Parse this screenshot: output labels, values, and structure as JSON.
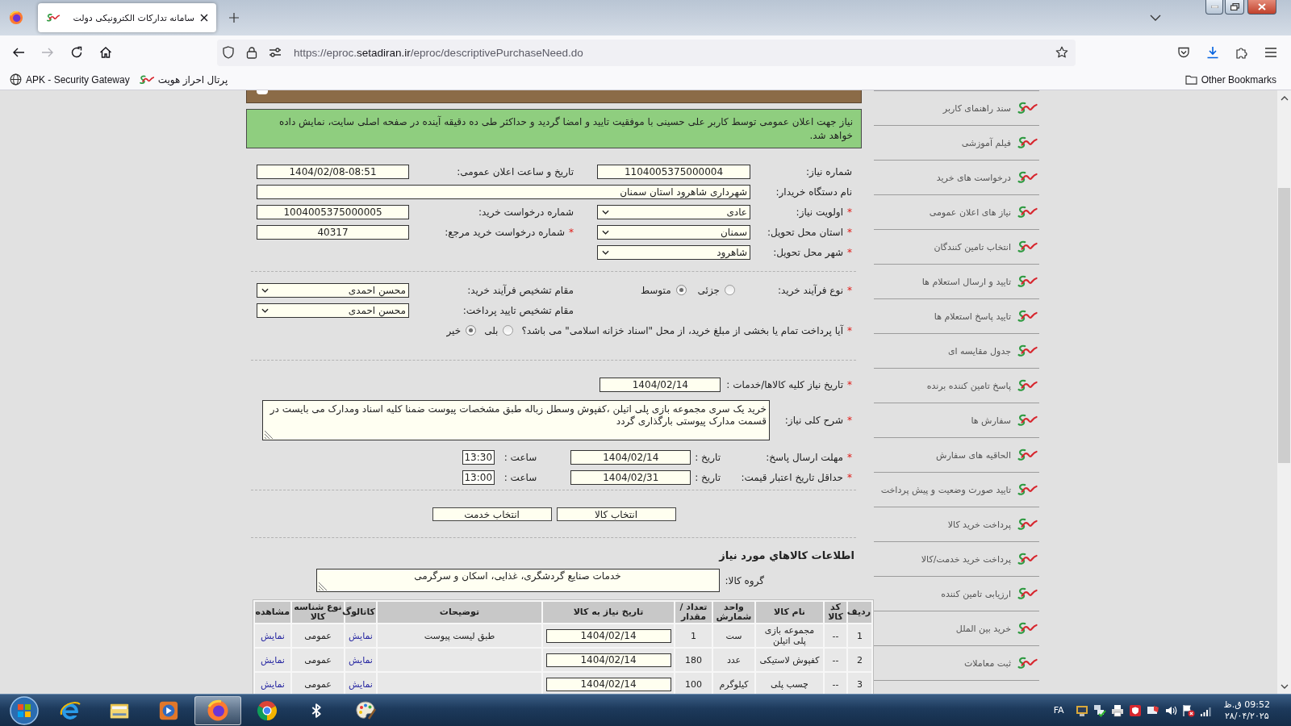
{
  "browser": {
    "tabs": [
      {
        "title": "سامانه تدارکات الکترونیکی دولت",
        "selected": true
      }
    ],
    "nav_buttons": [
      {
        "kind": "back",
        "disabled": false
      },
      {
        "kind": "forward",
        "disabled": true
      },
      {
        "kind": "reload",
        "disabled": false
      },
      {
        "kind": "home",
        "disabled": false
      }
    ],
    "address": {
      "prefix": "https://eproc.",
      "domain": "setadiran.ir",
      "path": "/eproc/descriptivePurchaseNeed.do"
    },
    "bookmarks_bar": {
      "gateway_bookmark": "APK - Security Gateway",
      "portal_bookmark": "پرتال احراز هویت",
      "other_bookmarks": "Other Bookmarks"
    }
  },
  "page": {
    "notice": "نیاز جهت اعلان عمومی توسط کاربر علی حسینی با موفقیت تایید و امضا گردید و حداکثر طی ده دقیقه آینده در صفحه اصلی سایت، نمایش داده خواهد شد.",
    "general_fields": [
      {
        "right": {
          "label": "شماره نیاز:",
          "kind": "text",
          "value": "1104005375000004"
        },
        "left": {
          "label": "تاریخ و ساعت اعلان عمومی:",
          "kind": "text",
          "value": "1404/02/08-08:51"
        }
      },
      {
        "right": {
          "label": "نام دستگاه خریدار:",
          "kind": "wide",
          "value": "شهرداری شاهرود استان سمنان"
        }
      },
      {
        "right": {
          "required_mark": "*",
          "label": "اولویت نیاز:",
          "kind": "select",
          "value": "عادی"
        },
        "left": {
          "label": "شماره درخواست خرید:",
          "kind": "text",
          "value": "1004005375000005"
        }
      },
      {
        "right": {
          "required_mark": "*",
          "label": "استان محل تحویل:",
          "kind": "select",
          "value": "سمنان"
        },
        "left": {
          "required_mark": "*",
          "label": "شماره درخواست خرید مرجع:",
          "kind": "text",
          "value": "40317"
        }
      },
      {
        "right": {
          "required_mark": "*",
          "label": "شهر محل تحویل:",
          "kind": "select",
          "value": "شاهرود"
        }
      }
    ],
    "process_fields": [
      {
        "right": {
          "required_mark": "*",
          "label": "نوع فرآیند خرید:",
          "kind": "radio",
          "options": [
            {
              "label": "جزئی",
              "selected": false
            },
            {
              "label": "متوسط",
              "selected": true
            }
          ]
        },
        "left": {
          "label": "مقام تشخیص فرآیند خرید:",
          "kind": "select",
          "value": "محسن احمدی"
        }
      },
      {
        "left": {
          "label": "مقام تشخیص تایید پرداخت:",
          "kind": "select",
          "value": "محسن احمدی"
        }
      }
    ],
    "treasury_question": {
      "required_mark": "*",
      "label": "آیا پرداخت تمام یا بخشی از مبلغ خرید، از محل \"اسناد خزانه اسلامی\" می باشد؟",
      "options": [
        {
          "label": "بلی",
          "selected": false
        },
        {
          "label": "خیر",
          "selected": true
        }
      ]
    },
    "need_date": {
      "required_mark": "*",
      "label": "تاریخ نیاز کلیه کالاها/خدمات :",
      "value": "1404/02/14"
    },
    "description": {
      "required_mark": "*",
      "label": "شرح کلی نیاز:",
      "value": "خرید یک سری مجموعه بازی پلی اتیلن ،کفپوش وسطل زباله طبق مشخصات پیوست ضمنا کلیه اسناد ومدارک می بایست در قسمت مدارک پیوستی بارگذاری گردد"
    },
    "deadlines": [
      {
        "required_mark": "*",
        "label": "مهلت ارسال پاسخ:",
        "date_label": "تاریخ :",
        "date": "1404/02/14",
        "time_label": "ساعت :",
        "time": "13:30"
      },
      {
        "required_mark": "*",
        "label": "حداقل تاریخ اعتبار قیمت:",
        "date_label": "تاریخ :",
        "date": "1404/02/31",
        "time_label": "ساعت :",
        "time": "13:00"
      }
    ],
    "buttons": [
      "انتخاب کالا",
      "انتخاب خدمت"
    ],
    "goods_title": "اطلاعات کالاهاي مورد نياز",
    "goods_group": {
      "label": "گروه کالا:",
      "value": "خدمات صنایع گردشگری، غذایی، اسکان و سرگرمی"
    },
    "table": {
      "columns": [
        "ردیف",
        "کد کالا",
        "نام کالا",
        "واحد شمارش",
        "تعداد / مقدار",
        "تاریخ نیاز به کالا",
        "توضیحات",
        "کاتالوگ",
        "نوع شناسه کالا",
        "مشاهده"
      ],
      "rows": [
        {
          "index": "1",
          "code": "--",
          "name": "مجموعه بازی پلی اتیلن",
          "unit": "ست",
          "quantity": "1",
          "need_date": "1404/02/14",
          "notes": "طبق لیست پیوست",
          "catalog": "نمایش",
          "id_type": "عمومی",
          "view": "نمایش"
        },
        {
          "index": "2",
          "code": "--",
          "name": "کفپوش لاستیکی",
          "unit": "عدد",
          "quantity": "180",
          "need_date": "1404/02/14",
          "catalog": "نمایش",
          "id_type": "عمومی",
          "view": "نمایش"
        },
        {
          "index": "3",
          "code": "--",
          "name": "چسب پلی",
          "unit": "کیلوگرم",
          "quantity": "100",
          "need_date": "1404/02/14",
          "catalog": "نمایش",
          "id_type": "عمومی",
          "view": "نمایش"
        }
      ]
    }
  },
  "sidebar": {
    "items": [
      "سند راهنمای کاربر",
      "فیلم آموزشی",
      "درخواست های خرید",
      "نیاز های اعلان عمومی",
      "انتخاب تامین کنندگان",
      "تایید و ارسال استعلام ها",
      "تایید پاسخ استعلام ها",
      "جدول مقایسه ای",
      "پاسخ تامین کننده برنده",
      "سفارش ها",
      "الحاقیه های سفارش",
      "تایید صورت وضعیت و پیش پرداخت",
      "پرداخت خرید کالا",
      "پرداخت خرید خدمت/کالا",
      "ارزیابی تامین کننده",
      "خرید بین الملل",
      "ثبت معاملات"
    ]
  },
  "taskbar": {
    "apps": [
      {
        "kind": "ie",
        "selected": false
      },
      {
        "kind": "explorer",
        "selected": false
      },
      {
        "kind": "media",
        "selected": false
      },
      {
        "kind": "firefox",
        "selected": true
      },
      {
        "kind": "chrome",
        "selected": false
      },
      {
        "kind": "bluetooth",
        "selected": false
      },
      {
        "kind": "paint",
        "selected": false
      }
    ],
    "language": "FA",
    "time": "09:52 ق.ظ",
    "date": "۲۸/۰۴/۲۰۲۵"
  }
}
